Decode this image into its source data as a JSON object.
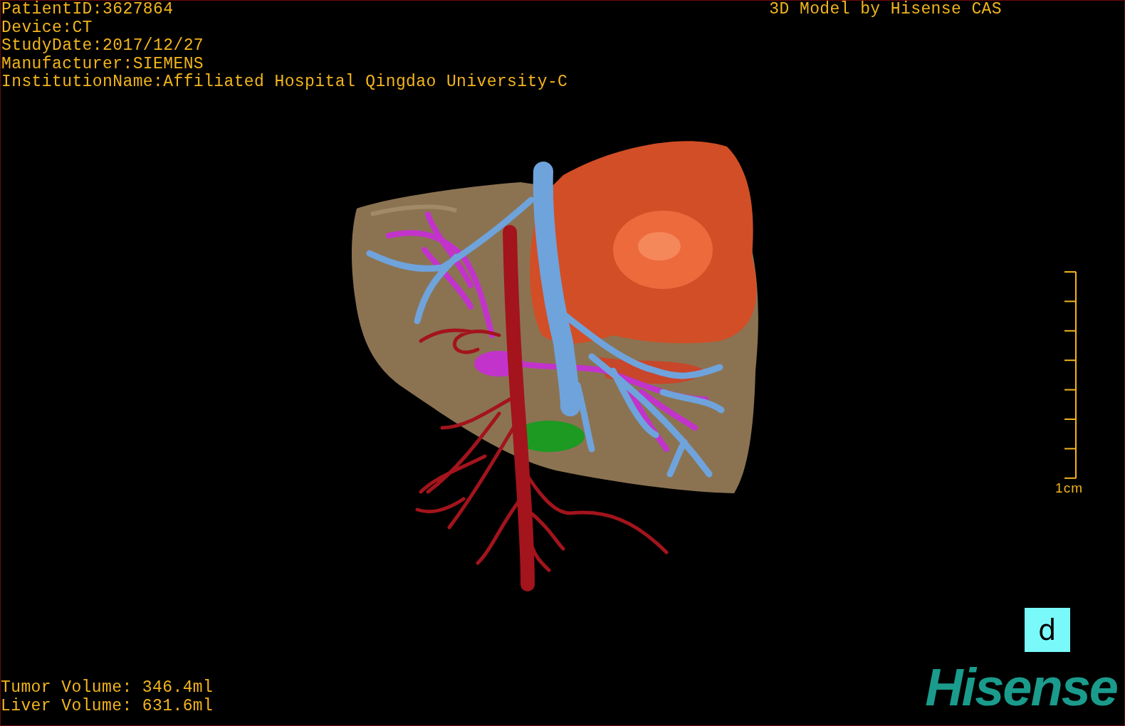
{
  "patient_info": [
    "PatientID:3627864",
    "Device:CT",
    "StudyDate:2017/12/27",
    "Manufacturer:SIEMENS",
    "InstitutionName:Affiliated Hospital Qingdao University-C"
  ],
  "title": "3D Model by Hisense CAS",
  "scale_bar": {
    "label": "1cm"
  },
  "orientation_marker": "d",
  "volumes": [
    "Tumor Volume: 346.4ml",
    "Liver Volume: 631.6ml"
  ],
  "logo": "Hisense"
}
